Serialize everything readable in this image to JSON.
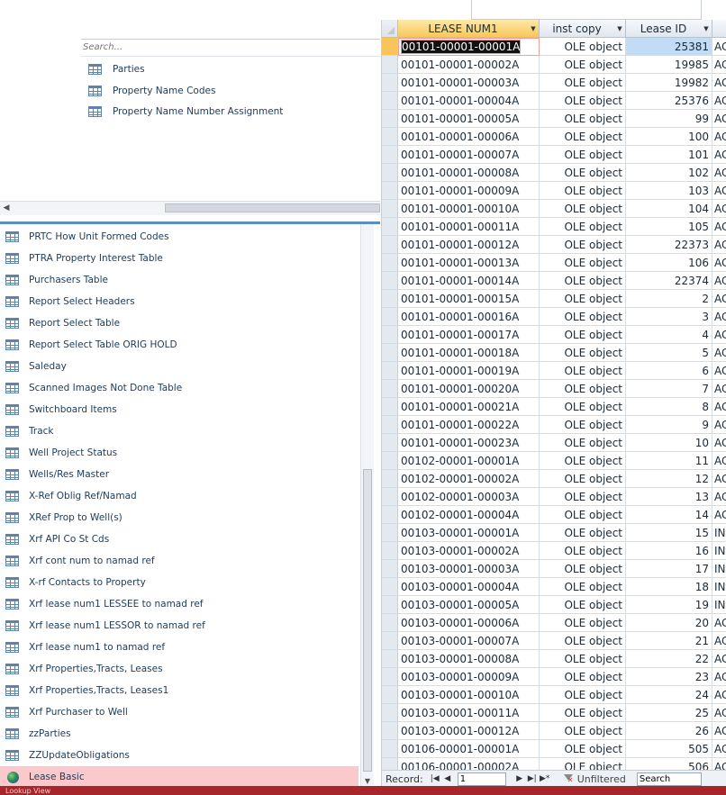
{
  "search": {
    "placeholder": "Search..."
  },
  "top_items": [
    {
      "label": "Parties"
    },
    {
      "label": "Property Name Codes"
    },
    {
      "label": "Property Name Number Assignment"
    }
  ],
  "nav_items": [
    {
      "label": "PRTC How Unit Formed Codes"
    },
    {
      "label": "PTRA Property Interest Table"
    },
    {
      "label": "Purchasers Table"
    },
    {
      "label": "Report Select Headers"
    },
    {
      "label": "Report Select Table"
    },
    {
      "label": "Report Select Table ORIG HOLD"
    },
    {
      "label": "Saleday"
    },
    {
      "label": "Scanned Images Not Done Table"
    },
    {
      "label": "Switchboard Items"
    },
    {
      "label": "Track"
    },
    {
      "label": "Well Project Status"
    },
    {
      "label": "Wells/Res Master"
    },
    {
      "label": "X-Ref Oblig Ref/Namad"
    },
    {
      "label": "XRef Prop to Well(s)"
    },
    {
      "label": "Xrf API Co St Cds"
    },
    {
      "label": "Xrf cont num to namad ref"
    },
    {
      "label": "X-rf Contacts to Property"
    },
    {
      "label": "Xrf lease num1 LESSEE  to namad ref"
    },
    {
      "label": "Xrf lease num1 LESSOR to namad ref"
    },
    {
      "label": "Xrf lease num1 to namad ref"
    },
    {
      "label": "Xrf Properties,Tracts, Leases"
    },
    {
      "label": "Xrf Properties,Tracts, Leases1"
    },
    {
      "label": "Xrf Purchaser to Well"
    },
    {
      "label": "zzParties"
    },
    {
      "label": "ZZUpdateObligations"
    }
  ],
  "selected_nav_item": {
    "label": "Lease Basic",
    "icon": "globe-icon"
  },
  "datasheet": {
    "columns": [
      "LEASE NUM1",
      "inst copy",
      "Lease ID",
      ""
    ],
    "rows": [
      [
        "00101-00001-00001A",
        "OLE object",
        "25381",
        "AC"
      ],
      [
        "00101-00001-00002A",
        "OLE object",
        "19985",
        "AC"
      ],
      [
        "00101-00001-00003A",
        "OLE object",
        "19982",
        "AC"
      ],
      [
        "00101-00001-00004A",
        "OLE object",
        "25376",
        "AC"
      ],
      [
        "00101-00001-00005A",
        "OLE object",
        "99",
        "AC"
      ],
      [
        "00101-00001-00006A",
        "OLE object",
        "100",
        "AC"
      ],
      [
        "00101-00001-00007A",
        "OLE object",
        "101",
        "AC"
      ],
      [
        "00101-00001-00008A",
        "OLE object",
        "102",
        "AC"
      ],
      [
        "00101-00001-00009A",
        "OLE object",
        "103",
        "AC"
      ],
      [
        "00101-00001-00010A",
        "OLE object",
        "104",
        "AC"
      ],
      [
        "00101-00001-00011A",
        "OLE object",
        "105",
        "AC"
      ],
      [
        "00101-00001-00012A",
        "OLE object",
        "22373",
        "AC"
      ],
      [
        "00101-00001-00013A",
        "OLE object",
        "106",
        "AC"
      ],
      [
        "00101-00001-00014A",
        "OLE object",
        "22374",
        "AC"
      ],
      [
        "00101-00001-00015A",
        "OLE object",
        "2",
        "AC"
      ],
      [
        "00101-00001-00016A",
        "OLE object",
        "3",
        "AC"
      ],
      [
        "00101-00001-00017A",
        "OLE object",
        "4",
        "AC"
      ],
      [
        "00101-00001-00018A",
        "OLE object",
        "5",
        "AC"
      ],
      [
        "00101-00001-00019A",
        "OLE object",
        "6",
        "AC"
      ],
      [
        "00101-00001-00020A",
        "OLE object",
        "7",
        "AC"
      ],
      [
        "00101-00001-00021A",
        "OLE object",
        "8",
        "AC"
      ],
      [
        "00101-00001-00022A",
        "OLE object",
        "9",
        "AC"
      ],
      [
        "00101-00001-00023A",
        "OLE object",
        "10",
        "AC"
      ],
      [
        "00102-00001-00001A",
        "OLE object",
        "11",
        "AC"
      ],
      [
        "00102-00001-00002A",
        "OLE object",
        "12",
        "AC"
      ],
      [
        "00102-00001-00003A",
        "OLE object",
        "13",
        "AC"
      ],
      [
        "00102-00001-00004A",
        "OLE object",
        "14",
        "AC"
      ],
      [
        "00103-00001-00001A",
        "OLE object",
        "15",
        "IN"
      ],
      [
        "00103-00001-00002A",
        "OLE object",
        "16",
        "IN"
      ],
      [
        "00103-00001-00003A",
        "OLE object",
        "17",
        "IN"
      ],
      [
        "00103-00001-00004A",
        "OLE object",
        "18",
        "IN"
      ],
      [
        "00103-00001-00005A",
        "OLE object",
        "19",
        "IN"
      ],
      [
        "00103-00001-00006A",
        "OLE object",
        "20",
        "AC"
      ],
      [
        "00103-00001-00007A",
        "OLE object",
        "21",
        "AC"
      ],
      [
        "00103-00001-00008A",
        "OLE object",
        "22",
        "AC"
      ],
      [
        "00103-00001-00009A",
        "OLE object",
        "23",
        "AC"
      ],
      [
        "00103-00001-00010A",
        "OLE object",
        "24",
        "AC"
      ],
      [
        "00103-00001-00011A",
        "OLE object",
        "25",
        "AC"
      ],
      [
        "00103-00001-00012A",
        "OLE object",
        "26",
        "AC"
      ],
      [
        "00106-00001-00001A",
        "OLE object",
        "505",
        "AC"
      ],
      [
        "00106-00001-00002A",
        "OLE object",
        "506",
        "AC"
      ]
    ]
  },
  "record_nav": {
    "label": "Record:",
    "current": "1",
    "filter_label": "Unfiltered",
    "search_label": "Search"
  },
  "status": {
    "text": "Lookup View"
  },
  "colors": {
    "selected_row": "#f9c55b",
    "selected_nav": "#fbc9cc",
    "status_bar": "#a6262b",
    "nav_border": "#5b8fc4"
  }
}
